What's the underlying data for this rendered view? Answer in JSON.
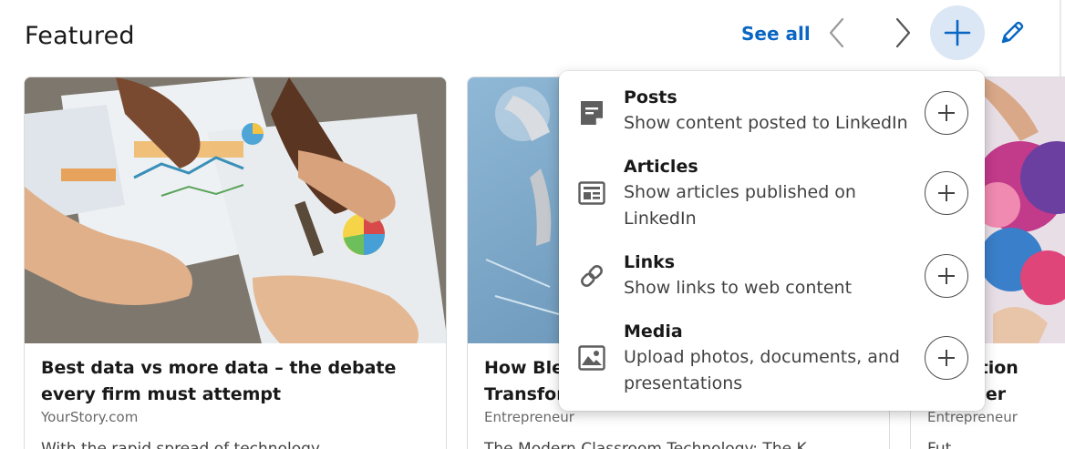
{
  "header": {
    "title": "Featured",
    "see_all": "See all"
  },
  "colors": {
    "accent": "#0a66c2",
    "add_button_bg": "#dbe7f5"
  },
  "icons": {
    "prev": "chevron-left-icon",
    "next": "chevron-right-icon",
    "add": "plus-icon",
    "edit": "pencil-icon"
  },
  "cards": [
    {
      "title": "Best data vs more data – the debate every firm must attempt",
      "source": "YourStory.com",
      "snippet": "With the rapid spread of technology..."
    },
    {
      "title": "How Blen... Transfor...",
      "source": "Entrepreneur",
      "snippet": "The Modern Classroom: Technology: The K..."
    },
    {
      "title": "...unication ... Another",
      "source": "Entrepreneur",
      "snippet": "Fut..."
    }
  ],
  "card_visible_lines": {
    "card2_title_line1": "How Blen",
    "card2_title_line2": "Transfor",
    "card2_snippet": "The Modern Classroom Technology: The K",
    "card3_title_line1": "unication",
    "card3_title_line2": "Another",
    "card3_snippet": "Fut",
    "card1_snippet": "With the rapid spread of technology"
  },
  "dropdown": {
    "items": [
      {
        "title": "Posts",
        "description": "Show content posted to LinkedIn",
        "icon": "post-icon"
      },
      {
        "title": "Articles",
        "description": "Show articles published on LinkedIn",
        "icon": "article-icon"
      },
      {
        "title": "Links",
        "description": "Show links to web content",
        "icon": "link-icon"
      },
      {
        "title": "Media",
        "description": "Upload photos, documents, and presentations",
        "icon": "media-icon"
      }
    ]
  }
}
